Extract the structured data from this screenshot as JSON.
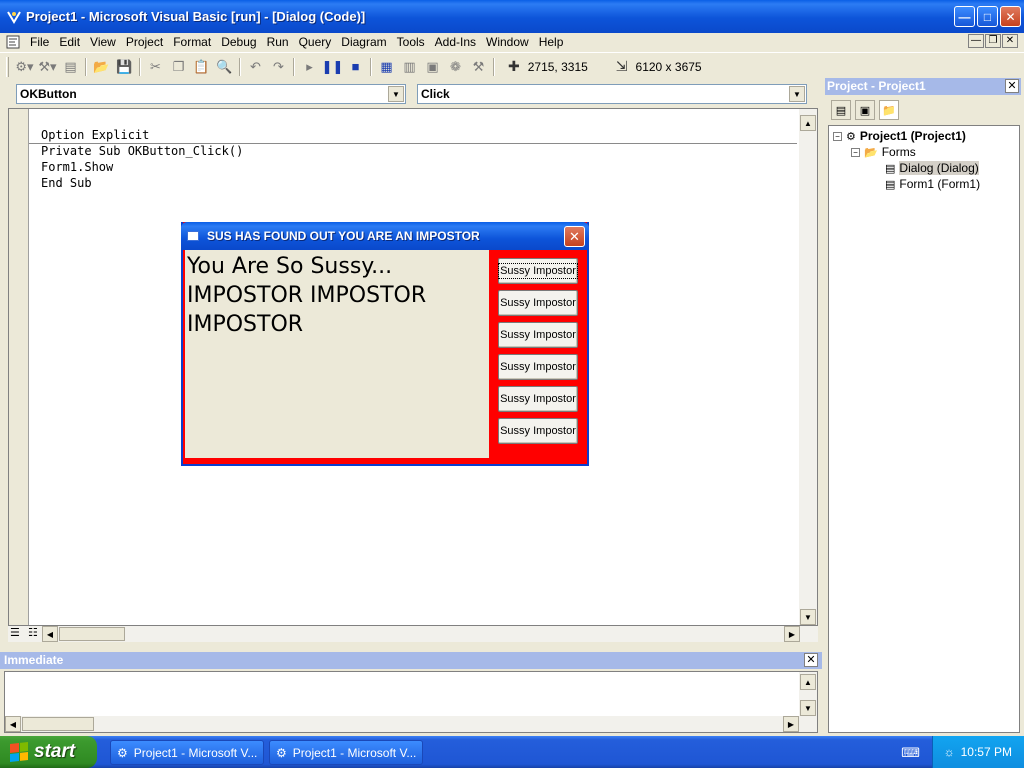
{
  "window": {
    "title": "Project1 - Microsoft Visual Basic [run] - [Dialog (Code)]",
    "controls": [
      "minimize",
      "maximize",
      "close"
    ]
  },
  "menu": {
    "items": [
      {
        "label": "File"
      },
      {
        "label": "Edit"
      },
      {
        "label": "View"
      },
      {
        "label": "Project"
      },
      {
        "label": "Format"
      },
      {
        "label": "Debug"
      },
      {
        "label": "Run"
      },
      {
        "label": "Query"
      },
      {
        "label": "Diagram"
      },
      {
        "label": "Tools"
      },
      {
        "label": "Add-Ins"
      },
      {
        "label": "Window"
      },
      {
        "label": "Help"
      }
    ]
  },
  "toolbar": {
    "position_readout": "2715, 3315",
    "size_readout": "6120 x 3675",
    "icons": [
      "add-project-icon",
      "add-form-icon",
      "menu-editor-icon",
      "open-icon",
      "save-icon",
      "cut-icon",
      "copy-icon",
      "paste-icon",
      "find-icon",
      "undo-icon",
      "redo-icon",
      "start-icon",
      "break-icon",
      "end-icon",
      "project-explorer-icon",
      "properties-icon",
      "form-layout-icon",
      "object-browser-icon",
      "toolbox-icon"
    ]
  },
  "code_window": {
    "object_combo": "OKButton",
    "procedure_combo": "Click",
    "lines": [
      "Option Explicit",
      "Private Sub OKButton_Click()",
      "Form1.Show",
      "End Sub"
    ]
  },
  "immediate": {
    "title": "Immediate"
  },
  "project_explorer": {
    "title": "Project - Project1",
    "tree": {
      "project": "Project1 (Project1)",
      "folder": "Forms",
      "items": [
        "Dialog (Dialog)",
        "Form1 (Form1)"
      ]
    }
  },
  "dialog": {
    "title": "SUS HAS FOUND OUT YOU ARE AN IMPOSTOR",
    "label_text": "You Are So Sussy... IMPOSTOR IMPOSTOR IMPOSTOR",
    "buttons": [
      "Sussy Impostor",
      "Sussy Impostor",
      "Sussy Impostor",
      "Sussy Impostor",
      "Sussy Impostor",
      "Sussy Impostor"
    ],
    "background_color": "#ff0000"
  },
  "taskbar": {
    "start_label": "start",
    "tasks": [
      "Project1 - Microsoft V...",
      "Project1 - Microsoft V..."
    ],
    "clock": "10:57 PM"
  }
}
